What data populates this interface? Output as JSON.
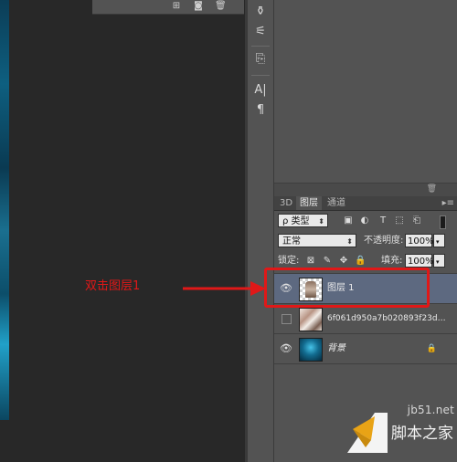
{
  "colors": {
    "annotation": "#e01818",
    "selected_row": "#5d6980",
    "panel": "#535353"
  },
  "top_panel": {
    "icons": [
      "new-layer-icon",
      "camera-icon",
      "trash-icon"
    ]
  },
  "toolbar": {
    "tools": [
      "brush-settings-icon",
      "brush-presets-icon",
      "clone-source-icon",
      "character-icon",
      "paragraph-icon"
    ],
    "character_glyph": "A|",
    "paragraph_glyph": "¶"
  },
  "layers_panel": {
    "tabs": [
      "3D",
      "图层",
      "通道"
    ],
    "active_tab": "图层",
    "filter": {
      "label": "ρ 类型",
      "icons": [
        "image-filter-icon",
        "adjustment-filter-icon",
        "type-filter-icon",
        "shape-filter-icon",
        "smart-object-filter-icon"
      ]
    },
    "blend_mode": "正常",
    "opacity": {
      "label": "不透明度:",
      "value": "100%"
    },
    "lock": {
      "label": "锁定:",
      "icons": [
        "lock-transparent-icon",
        "lock-paint-icon",
        "lock-position-icon",
        "lock-all-icon"
      ]
    },
    "fill": {
      "label": "填充:",
      "value": "100%"
    },
    "layers": [
      {
        "name": "图层 1",
        "visible": true,
        "selected": true,
        "thumb": "checker"
      },
      {
        "name": "6f061d950a7b020893f23d…",
        "visible": false,
        "selected": false,
        "thumb": "photo"
      },
      {
        "name": "背景",
        "visible": true,
        "selected": false,
        "thumb": "sea",
        "locked": true
      }
    ]
  },
  "annotation": {
    "text": "双击图层1"
  },
  "watermark": {
    "domain": "jb51.net",
    "brand": "脚本之家"
  }
}
